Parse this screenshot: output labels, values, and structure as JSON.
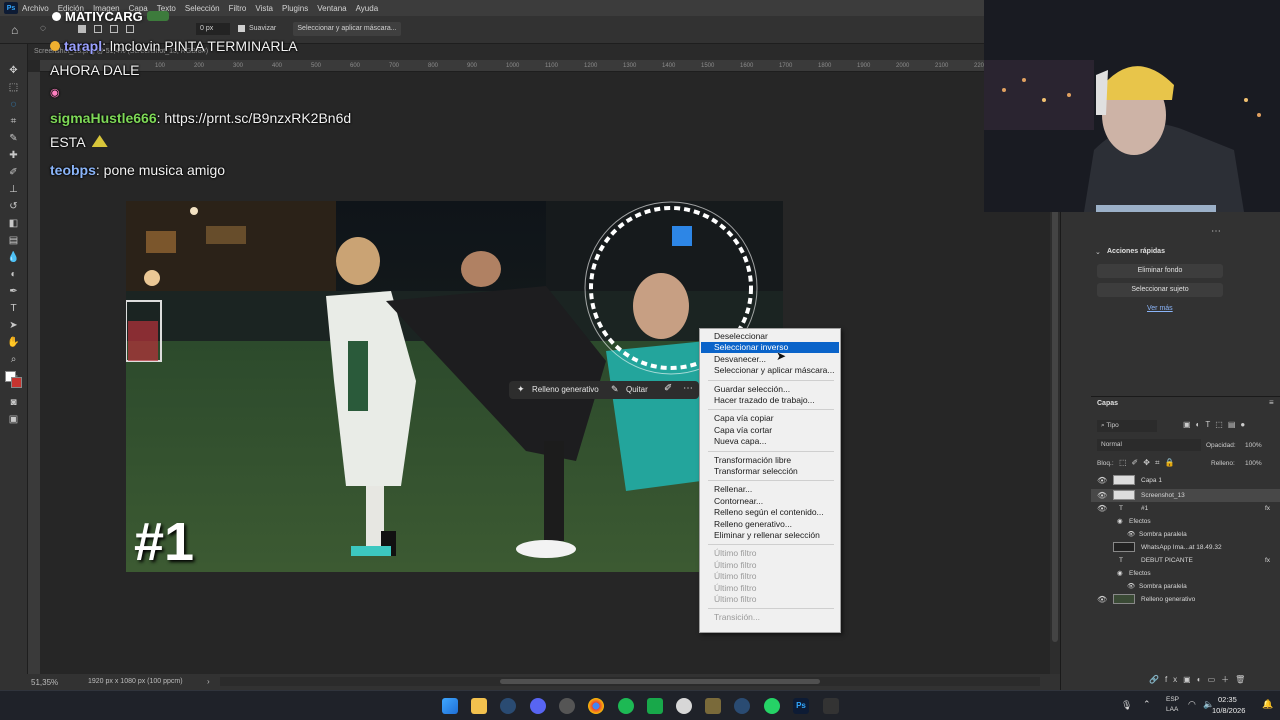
{
  "app": {
    "logo": "Ps"
  },
  "menu": {
    "items": [
      "Archivo",
      "Edición",
      "Imagen",
      "Capa",
      "Texto",
      "Selección",
      "Filtro",
      "Vista",
      "Plugins",
      "Ventana",
      "Ayuda"
    ]
  },
  "options_bar": {
    "feather_value": "0 px",
    "antialias_label": "Suavizar",
    "select_mask_button": "Seleccionar y aplicar máscara..."
  },
  "document_tab": {
    "label": "Screenshot_13.png @ 51,4% (Screenshot_13, RGB/8#) *"
  },
  "ruler_ticks": [
    "100",
    "200",
    "300",
    "400",
    "500",
    "600",
    "700",
    "800",
    "900",
    "1000",
    "1100",
    "1200",
    "1300",
    "1400",
    "1500",
    "1600",
    "1700",
    "1800",
    "1900",
    "2000",
    "2100",
    "2200",
    "2300",
    "2400"
  ],
  "stream_overlay": {
    "channel_name": "MATIYCARG"
  },
  "chat": [
    {
      "user": "tarapl",
      "text": "lmclovin PINTA TERMINARLA",
      "user_color": "#9aa0ff"
    },
    {
      "user": "",
      "text": "AHORA DALE",
      "user_color": ""
    },
    {
      "user": "",
      "text": "◉",
      "user_color": ""
    },
    {
      "user": "sigmaHustle666",
      "text": "https://prnt.sc/B9nzxRK2Bn6d",
      "user_color": "#7ed957"
    },
    {
      "user": "",
      "text": "ESTA",
      "user_color": ""
    },
    {
      "user": "teobps",
      "text": "pone musica amigo",
      "user_color": "#8ab4f8"
    }
  ],
  "image_overlay": {
    "number_label": "#1"
  },
  "contextual_bar": {
    "generative_fill": "Relleno generativo",
    "remove": "Quitar"
  },
  "context_menu": {
    "items": [
      {
        "label": "Deseleccionar",
        "state": "normal"
      },
      {
        "label": "Seleccionar inverso",
        "state": "selected"
      },
      {
        "label": "Desvanecer...",
        "state": "normal"
      },
      {
        "label": "Seleccionar y aplicar máscara...",
        "state": "normal"
      },
      {
        "label": "Guardar selección...",
        "state": "normal"
      },
      {
        "label": "Hacer trazado de trabajo...",
        "state": "normal"
      },
      {
        "label": "Capa vía copiar",
        "state": "normal"
      },
      {
        "label": "Capa vía cortar",
        "state": "normal"
      },
      {
        "label": "Nueva capa...",
        "state": "normal"
      },
      {
        "label": "Transformación libre",
        "state": "normal"
      },
      {
        "label": "Transformar selección",
        "state": "normal"
      },
      {
        "label": "Rellenar...",
        "state": "normal"
      },
      {
        "label": "Contornear...",
        "state": "normal"
      },
      {
        "label": "Relleno según el contenido...",
        "state": "normal"
      },
      {
        "label": "Relleno generativo...",
        "state": "normal"
      },
      {
        "label": "Eliminar y rellenar selección",
        "state": "normal"
      },
      {
        "label": "Último filtro",
        "state": "disabled"
      },
      {
        "label": "Último filtro",
        "state": "disabled"
      },
      {
        "label": "Último filtro",
        "state": "disabled"
      },
      {
        "label": "Último filtro",
        "state": "disabled"
      },
      {
        "label": "Último filtro",
        "state": "disabled"
      },
      {
        "label": "Transición...",
        "state": "disabled"
      }
    ]
  },
  "status_bar": {
    "zoom": "51,35%",
    "doc_info": "1920 px x 1080 px (100 ppcm)"
  },
  "quick_actions": {
    "title": "Acciones rápidas",
    "remove_bg": "Eliminar fondo",
    "select_subject": "Seleccionar sujeto",
    "see_more": "Ver más"
  },
  "layers_panel": {
    "title": "Capas",
    "filter": "Tipo",
    "blend_mode": "Normal",
    "opacity_label": "Opacidad:",
    "opacity_value": "100%",
    "lock_label": "Bloq.:",
    "fill_label": "Relleno:",
    "fill_value": "100%",
    "layers": [
      {
        "name": "Capa 1",
        "kind": "pixel",
        "visible": true,
        "indent": 0
      },
      {
        "name": "Screenshot_13",
        "kind": "pixel",
        "visible": true,
        "indent": 0
      },
      {
        "name": "#1",
        "kind": "text",
        "visible": true,
        "indent": 0
      },
      {
        "name": "Efectos",
        "kind": "effects",
        "visible": true,
        "indent": 1
      },
      {
        "name": "Sombra paralela",
        "kind": "effect",
        "visible": true,
        "indent": 2
      },
      {
        "name": "WhatsApp Ima...at 18.49.32",
        "kind": "smart",
        "visible": false,
        "indent": 0
      },
      {
        "name": "DEBUT PICANTE",
        "kind": "text",
        "visible": false,
        "indent": 0
      },
      {
        "name": "Efectos",
        "kind": "effects",
        "visible": false,
        "indent": 1
      },
      {
        "name": "Sombra paralela",
        "kind": "effect",
        "visible": false,
        "indent": 2
      },
      {
        "name": "Relleno generativo",
        "kind": "generative",
        "visible": true,
        "indent": 0
      }
    ]
  },
  "taskbar": {
    "lang_top": "ESP",
    "lang_bottom": "LAA",
    "time": "02:35",
    "date": "10/8/2026"
  },
  "colors": {
    "accent": "#0a63c9",
    "ps_blue": "#31a8ff",
    "chat_green": "#7ed957"
  }
}
